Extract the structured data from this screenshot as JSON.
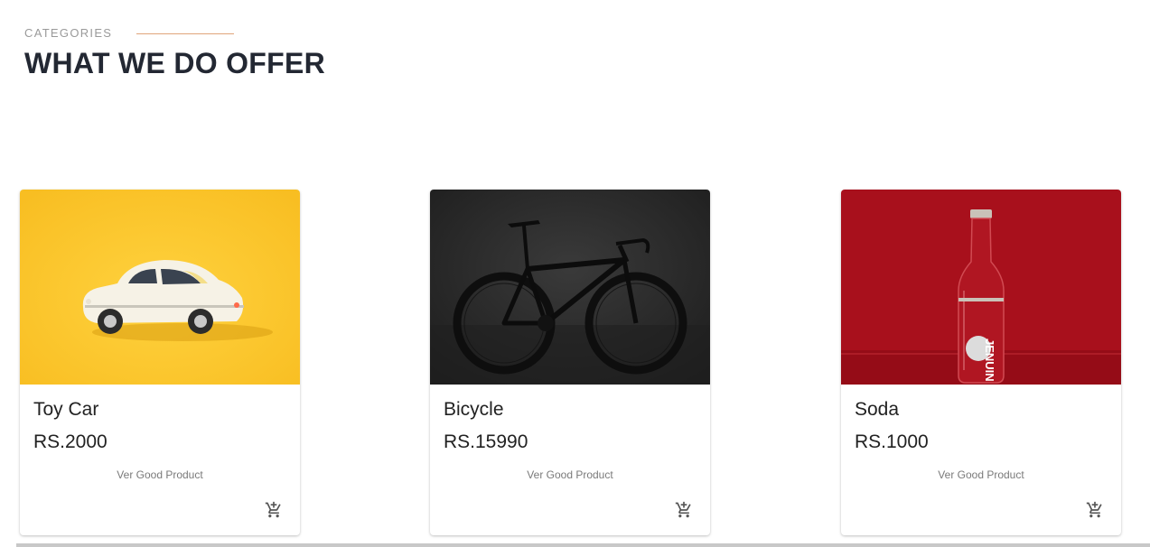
{
  "section": {
    "eyebrow": "CATEGORIES",
    "title": "WHAT WE DO OFFER",
    "accent_color": "#e0a57a",
    "title_color": "#232833"
  },
  "products": [
    {
      "name": "Toy Car",
      "price": "RS.2000",
      "description": "Ver Good Product",
      "image_icon": "toy-car-photo",
      "cart_icon": "add-to-cart-icon",
      "background": "#fcc72c"
    },
    {
      "name": "Bicycle",
      "price": "RS.15990",
      "description": "Ver Good Product",
      "image_icon": "bicycle-photo",
      "cart_icon": "add-to-cart-icon",
      "background": "#2a2a2a"
    },
    {
      "name": "Soda",
      "price": "RS.1000",
      "description": "Ver Good Product",
      "image_icon": "soda-bottle-photo",
      "cart_icon": "add-to-cart-icon",
      "background": "#a8101c",
      "bottle_label": "JENUIN"
    }
  ]
}
